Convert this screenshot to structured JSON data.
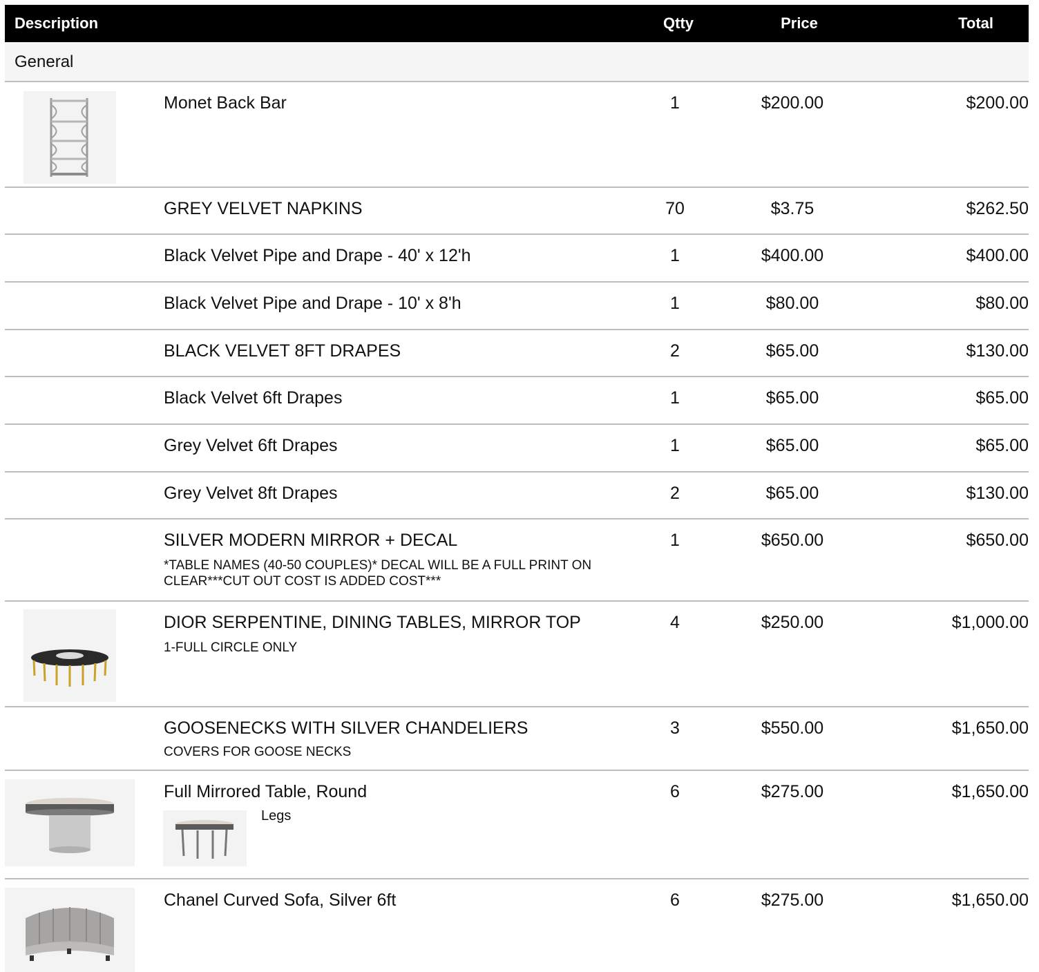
{
  "header": {
    "description": "Description",
    "qty": "Qtty",
    "price": "Price",
    "total": "Total"
  },
  "group": {
    "label": "General"
  },
  "rows": [
    {
      "description": "Monet Back Bar",
      "note": "",
      "qty": "1",
      "price": "$200.00",
      "total": "$200.00",
      "image_icon": "shelf-image-icon"
    },
    {
      "description": "GREY VELVET NAPKINS",
      "note": "",
      "qty": "70",
      "price": "$3.75",
      "total": "$262.50"
    },
    {
      "description": "Black Velvet Pipe and Drape - 40' x 12'h",
      "note": "",
      "qty": "1",
      "price": "$400.00",
      "total": "$400.00"
    },
    {
      "description": "Black Velvet Pipe and Drape - 10' x 8'h",
      "note": "",
      "qty": "1",
      "price": "$80.00",
      "total": "$80.00"
    },
    {
      "description": "BLACK VELVET 8FT DRAPES",
      "note": "",
      "qty": "2",
      "price": "$65.00",
      "total": "$130.00"
    },
    {
      "description": "Black Velvet 6ft Drapes",
      "note": "",
      "qty": "1",
      "price": "$65.00",
      "total": "$65.00"
    },
    {
      "description": "Grey Velvet 6ft Drapes",
      "note": "",
      "qty": "1",
      "price": "$65.00",
      "total": "$65.00"
    },
    {
      "description": "Grey Velvet 8ft Drapes",
      "note": "",
      "qty": "2",
      "price": "$65.00",
      "total": "$130.00"
    },
    {
      "description": "SILVER MODERN MIRROR + DECAL",
      "note": "*TABLE NAMES (40-50 COUPLES)* DECAL WILL BE A FULL PRINT ON CLEAR***CUT OUT COST IS ADDED COST***",
      "qty": "1",
      "price": "$650.00",
      "total": "$650.00"
    },
    {
      "description": "DIOR SERPENTINE, DINING TABLES, MIRROR TOP",
      "note": "1-FULL CIRCLE ONLY",
      "qty": "4",
      "price": "$250.00",
      "total": "$1,000.00",
      "image_icon": "serpentine-table-image-icon"
    },
    {
      "description": "GOOSENECKS WITH SILVER CHANDELIERS",
      "note": "COVERS FOR GOOSE NECKS",
      "qty": "3",
      "price": "$550.00",
      "total": "$1,650.00"
    },
    {
      "description": "Full Mirrored Table, Round",
      "note": "",
      "qty": "6",
      "price": "$275.00",
      "total": "$1,650.00",
      "image_icon": "round-table-image-icon",
      "option_label": "Legs",
      "option_icon": "round-table-legs-image-icon"
    },
    {
      "description": "Chanel Curved Sofa, Silver 6ft",
      "note": "",
      "qty": "6",
      "price": "$275.00",
      "total": "$1,650.00",
      "image_icon": "curved-sofa-image-icon"
    }
  ]
}
